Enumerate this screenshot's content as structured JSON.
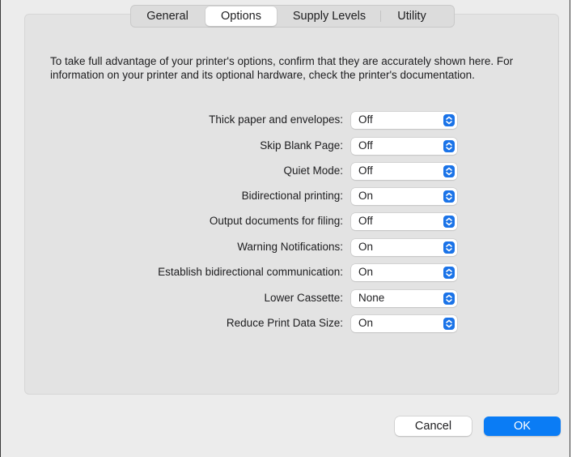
{
  "tabs": [
    {
      "label": "General",
      "active": false
    },
    {
      "label": "Options",
      "active": true
    },
    {
      "label": "Supply Levels",
      "active": false
    },
    {
      "label": "Utility",
      "active": false
    }
  ],
  "description": "To take full advantage of your printer's options, confirm that they are accurately shown here. For information on your printer and its optional hardware, check the printer's documentation.",
  "options": [
    {
      "label": "Thick paper and envelopes:",
      "value": "Off"
    },
    {
      "label": "Skip Blank Page:",
      "value": "Off"
    },
    {
      "label": "Quiet Mode:",
      "value": "Off"
    },
    {
      "label": "Bidirectional printing:",
      "value": "On"
    },
    {
      "label": "Output documents for filing:",
      "value": "Off"
    },
    {
      "label": "Warning Notifications:",
      "value": "On"
    },
    {
      "label": "Establish bidirectional communication:",
      "value": "On"
    },
    {
      "label": "Lower Cassette:",
      "value": "None"
    },
    {
      "label": "Reduce Print Data Size:",
      "value": "On"
    }
  ],
  "buttons": {
    "cancel": "Cancel",
    "ok": "OK"
  },
  "colors": {
    "accent": "#0a7cf5",
    "popup_arrow": "#1a73e8"
  },
  "icons": {
    "popup_indicator": "up-down-chevron-icon"
  }
}
